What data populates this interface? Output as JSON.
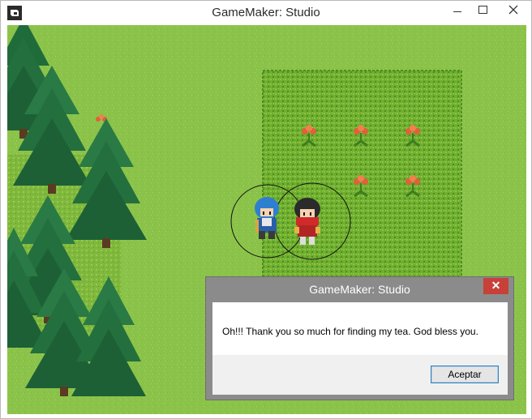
{
  "window": {
    "title": "GameMaker: Studio",
    "app_icon": "gamemaker-logo-icon",
    "controls": [
      "minimize-icon",
      "maximize-icon",
      "close-icon"
    ]
  },
  "dialog": {
    "title": "GameMaker: Studio",
    "close_label": "✕",
    "message": "Oh!!! Thank you so much for finding my tea. God bless you.",
    "ok_label": "Aceptar",
    "close_color": "#c7403a"
  },
  "scene": {
    "grass_color": "#8bc34a",
    "hedge_color": "#6aa82d",
    "tree_color": "#1f6b3a",
    "flower_color": "#e0603a",
    "characters": [
      "blue-haired-character",
      "red-scarf-character"
    ]
  }
}
